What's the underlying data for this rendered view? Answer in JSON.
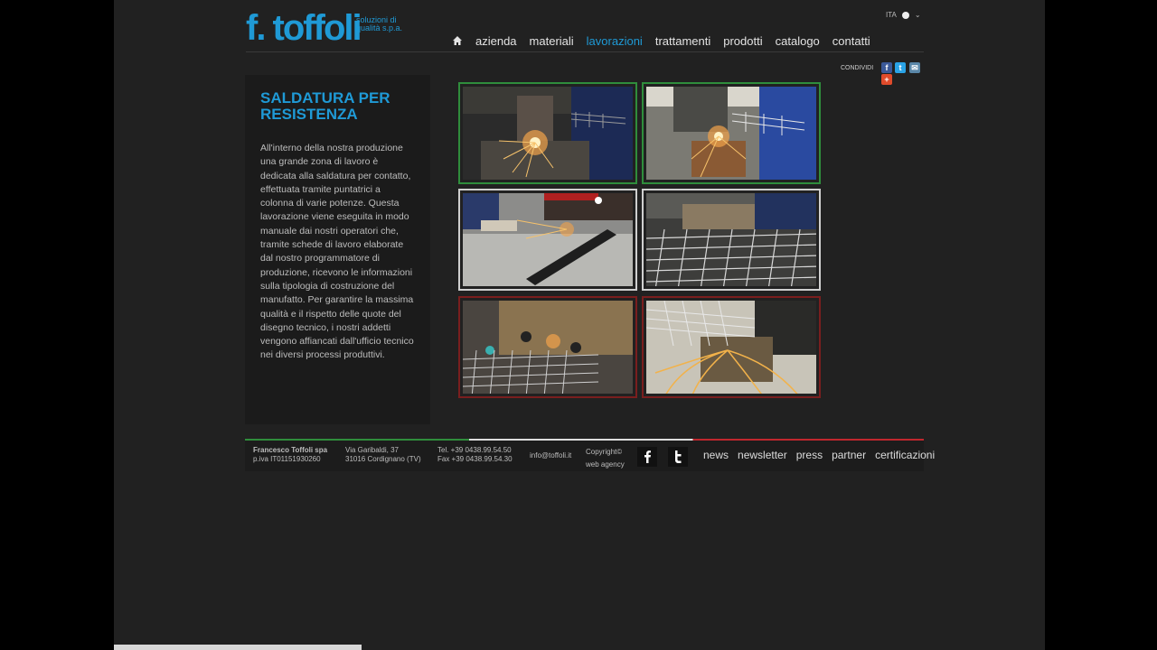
{
  "header": {
    "logo_text": "f. toffoli",
    "logo_tagline": "soluzioni di qualità s.p.a.",
    "language": "ITA"
  },
  "nav": {
    "items": [
      {
        "label": "azienda"
      },
      {
        "label": "materiali"
      },
      {
        "label": "lavorazioni",
        "active": true
      },
      {
        "label": "trattamenti"
      },
      {
        "label": "prodotti"
      },
      {
        "label": "catalogo"
      },
      {
        "label": "contatti"
      }
    ]
  },
  "share": {
    "label": "CONDIVIDI"
  },
  "article": {
    "title": "SALDATURA PER RESISTENZA",
    "body": "All'interno della nostra produzione una grande zona di lavoro è dedicata alla saldatura per contatto, effettuata tramite puntatrici a colonna di varie potenze. Questa lavorazione viene eseguita in modo manuale dai nostri operatori che, tramite schede di lavoro elaborate dal nostro programmatore di produzione, ricevono le informazioni sulla tipologia di costruzione del manufatto. Per garantire la massima qualità e il rispetto delle quote del disegno tecnico, i nostri addetti vengono affiancati dall'ufficio tecnico nei diversi processi produttivi."
  },
  "footer": {
    "company": "Francesco Toffoli spa",
    "piva": "p.iva IT01151930260",
    "address_line1": "Via Garibaldi, 37",
    "address_line2": "31016 Cordignano (TV)",
    "tel": "Tel. +39 0438.99.54.50",
    "fax": "Fax +39 0438.99.54.30",
    "email": "info@toffoli.it",
    "copyright": "Copyright©",
    "agency": "web agency",
    "links": [
      "news",
      "newsletter",
      "press",
      "partner",
      "certificazioni"
    ]
  },
  "colors": {
    "accent": "#1f9ad6",
    "background": "#212121",
    "green_frame": "#2f8d3c",
    "red_frame": "#7a1e1e"
  }
}
